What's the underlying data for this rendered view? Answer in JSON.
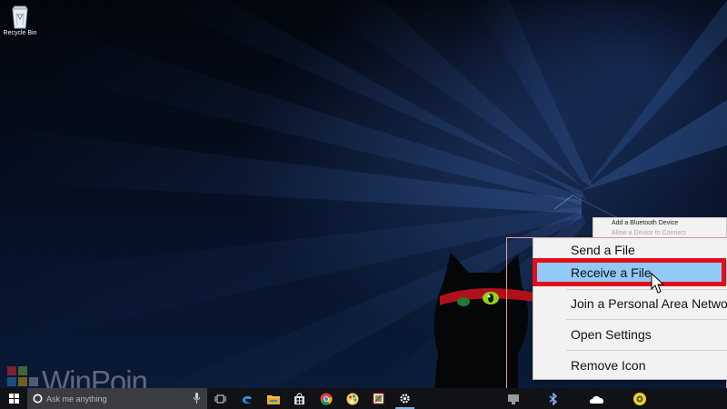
{
  "desktop": {
    "recycle_bin_label": "Recycle Bin",
    "watermark": "WinPoin"
  },
  "bluetooth_menu": {
    "items": [
      {
        "label": "Add a Bluetooth Device"
      },
      {
        "label": "Allow a Device to Connect"
      }
    ]
  },
  "context_menu": {
    "items": [
      {
        "label": "Send a File",
        "state": "normal"
      },
      {
        "label": "Receive a File",
        "state": "hover"
      },
      {
        "label": "Join a Personal Area Network",
        "state": "normal"
      },
      {
        "label": "Open Settings",
        "state": "normal"
      },
      {
        "label": "Remove Icon",
        "state": "normal"
      }
    ],
    "highlight_color": "#e0101a",
    "hover_color": "#91c9f7"
  },
  "taskbar": {
    "search_placeholder": "Ask me anything",
    "pinned": [
      {
        "icon": "task-view-icon"
      },
      {
        "icon": "edge-icon"
      },
      {
        "icon": "file-explorer-icon"
      },
      {
        "icon": "store-icon"
      },
      {
        "icon": "chrome-icon"
      },
      {
        "icon": "paint-icon"
      },
      {
        "icon": "snipping-icon"
      },
      {
        "icon": "settings-icon"
      }
    ],
    "tray_icons": [
      "usb-icon",
      "bluetooth-icon",
      "onedrive-icon",
      "security-icon"
    ]
  }
}
